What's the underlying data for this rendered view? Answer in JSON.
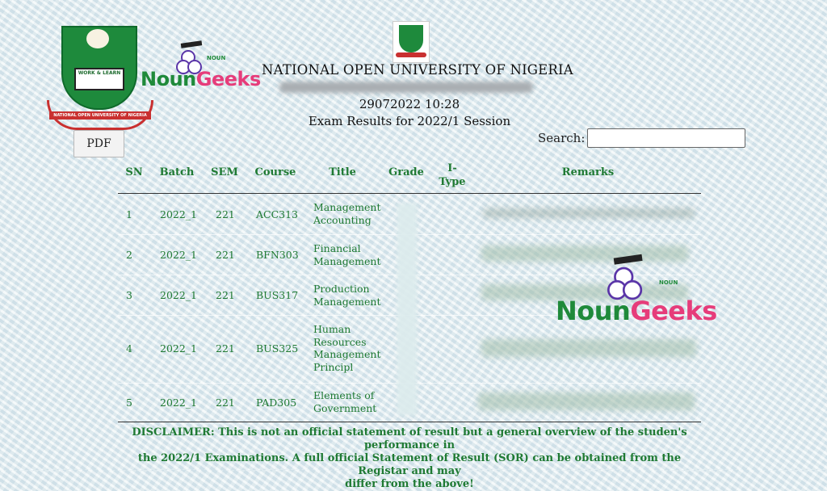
{
  "header": {
    "university": "NATIONAL OPEN UNIVERSITY OF NIGERIA",
    "datetime": "29072022 10:28",
    "session": "Exam Results for 2022/1 Session",
    "crest_motto": "WORK & LEARN",
    "crest_ribbon": "NATIONAL OPEN UNIVERSITY OF NIGERIA"
  },
  "brand": {
    "part1": "Noun",
    "part2": "Geeks",
    "small": "NOUN",
    "color1": "#1f8a3a",
    "color2": "#e63c7a"
  },
  "toolbar": {
    "pdf_label": "PDF",
    "search_label": "Search:",
    "search_value": ""
  },
  "table": {
    "headers": {
      "sn": "SN",
      "batch": "Batch",
      "sem": "SEM",
      "course": "Course",
      "title": "Title",
      "grade": "Grade",
      "itype_1": "I-",
      "itype_2": "Type",
      "remarks": "Remarks"
    },
    "rows": [
      {
        "sn": "1",
        "batch": "2022_1",
        "sem": "221",
        "course": "ACC313",
        "title": "Management Accounting"
      },
      {
        "sn": "2",
        "batch": "2022_1",
        "sem": "221",
        "course": "BFN303",
        "title": "Financial Management"
      },
      {
        "sn": "3",
        "batch": "2022_1",
        "sem": "221",
        "course": "BUS317",
        "title": "Production Management"
      },
      {
        "sn": "4",
        "batch": "2022_1",
        "sem": "221",
        "course": "BUS325",
        "title": "Human Resources Management Principl"
      },
      {
        "sn": "5",
        "batch": "2022_1",
        "sem": "221",
        "course": "PAD305",
        "title": "Elements of Government"
      }
    ]
  },
  "disclaimer": {
    "line1": "DISCLAIMER: This is not an official statement of result but a general overview of the studen's performance in",
    "line2": "the 2022/1 Examinations. A full official Statement of Result (SOR) can be obtained from the Registar and may",
    "line3": "differ from the above!"
  },
  "colors": {
    "accent_green": "#1f7a33"
  }
}
